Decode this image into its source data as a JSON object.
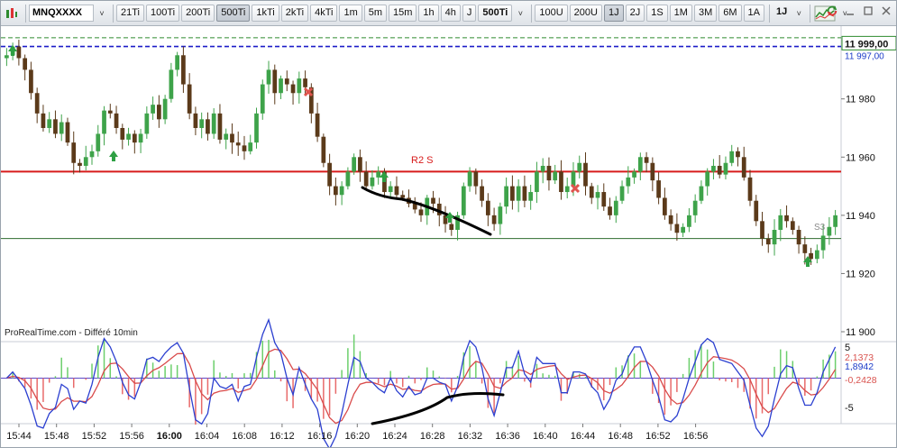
{
  "toolbar": {
    "symbol": "MNQXXXX",
    "timeframes": [
      "21Ti",
      "100Ti",
      "200Ti",
      "500Ti",
      "1kTi",
      "2kTi",
      "4kTi",
      "1m",
      "5m",
      "15m",
      "1h",
      "4h",
      "J"
    ],
    "active_timeframe": "500Ti",
    "current_timeframe": "500Ti",
    "units_selector": [
      "100U",
      "200U",
      "1J",
      "2J",
      "1S",
      "1M",
      "3M",
      "6M",
      "1A"
    ],
    "active_unit": "1J",
    "period_label": "1J",
    "dropdown_glyph": "˅"
  },
  "chart_data": {
    "type": "candlestick",
    "source_label": "ProRealTime.com - Différé 10min",
    "price_axis": {
      "ticks": [
        "11 980",
        "11 960",
        "11 940",
        "11 920",
        "11 900"
      ],
      "last_price": "11 999,00",
      "secondary_price": "11 997,00",
      "ylim": [
        11900,
        12005
      ]
    },
    "time_axis": {
      "ticks": [
        "15:44",
        "15:48",
        "15:52",
        "15:56",
        "16:00",
        "16:04",
        "16:08",
        "16:12",
        "16:16",
        "16:20",
        "16:24",
        "16:28",
        "16:32",
        "16:36",
        "16:40",
        "16:44",
        "16:48",
        "16:52",
        "16:56"
      ],
      "bold_tick": "16:00"
    },
    "horizontal_lines": [
      {
        "name": "resistance",
        "value": 11955,
        "color": "#d81b1b"
      },
      {
        "name": "support",
        "value": 11932,
        "color": "#2f6b2f"
      },
      {
        "name": "dashed-blue",
        "value": 11998,
        "color": "#1c1cc8"
      },
      {
        "name": "dashed-green",
        "value": 12001,
        "color": "#2e8b2e"
      }
    ],
    "annotation": {
      "text": "R2 S",
      "color": "#d81b1b"
    },
    "small_label": "S3",
    "close_path": [
      11995,
      11998,
      11994,
      11990,
      11982,
      11975,
      11970,
      11973,
      11968,
      11972,
      11965,
      11958,
      11957,
      11960,
      11962,
      11968,
      11976,
      11975,
      11970,
      11966,
      11968,
      11965,
      11968,
      11975,
      11978,
      11973,
      11980,
      11990,
      11995,
      11985,
      11975,
      11970,
      11973,
      11968,
      11975,
      11966,
      11968,
      11965,
      11964,
      11962,
      11965,
      11975,
      11985,
      11990,
      11982,
      11987,
      11985,
      11982,
      11987,
      11984,
      11975,
      11967,
      11958,
      11950,
      11947,
      11950,
      11955,
      11960,
      11955,
      11950,
      11953,
      11955,
      11948,
      11950,
      11947,
      11946,
      11944,
      11942,
      11940,
      11946,
      11944,
      11940,
      11937,
      11935,
      11940,
      11950,
      11955,
      11950,
      11945,
      11940,
      11937,
      11943,
      11950,
      11945,
      11950,
      11945,
      11948,
      11955,
      11957,
      11952,
      11955,
      11948,
      11950,
      11955,
      11958,
      11950,
      11946,
      11948,
      11943,
      11940,
      11945,
      11950,
      11953,
      11955,
      11960,
      11958,
      11952,
      11946,
      11940,
      11937,
      11934,
      11936,
      11940,
      11945,
      11950,
      11955,
      11957,
      11954,
      11958,
      11962,
      11960,
      11953,
      11945,
      11938,
      11932,
      11930,
      11935,
      11940,
      11938,
      11935,
      11930,
      11927,
      11925,
      11928,
      11933,
      11936,
      11940
    ],
    "indicator": {
      "ticks": [
        "5",
        "-5"
      ],
      "values": [
        "2,1373",
        "1,8942",
        "-0,2428"
      ],
      "value_colors": [
        "#d9534f",
        "#1c3cc8",
        "#d9534f"
      ]
    },
    "grid": false,
    "legend": "none"
  },
  "colors": {
    "up_candle": "#3ea34a",
    "down_candle": "#5b3a1a",
    "signal_up": "#2ea043",
    "signal_cross": "#e0544e",
    "trendline": "#000000",
    "macd_line": "#2b3fd0",
    "signal_line": "#d94b4b",
    "hist_up": "#6ccf6c",
    "hist_down": "#e86a6a",
    "price_badge_bg": "#ffffff"
  },
  "icons": [
    "chart-app-icon",
    "dropdown-icon",
    "indicator-icon",
    "refresh-icon",
    "minimize-icon",
    "maximize-icon",
    "close-icon",
    "up-arrow-icon",
    "cross-icon"
  ]
}
